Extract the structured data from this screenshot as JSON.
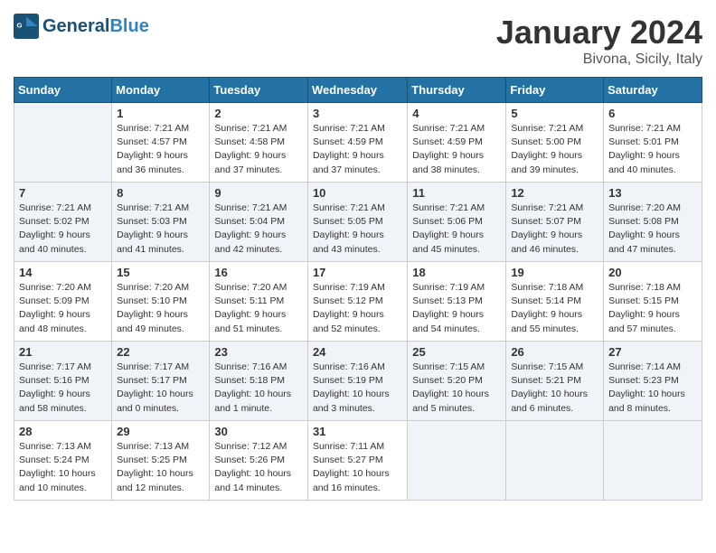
{
  "header": {
    "logo_line1": "General",
    "logo_line2": "Blue",
    "month_title": "January 2024",
    "subtitle": "Bivona, Sicily, Italy"
  },
  "weekdays": [
    "Sunday",
    "Monday",
    "Tuesday",
    "Wednesday",
    "Thursday",
    "Friday",
    "Saturday"
  ],
  "weeks": [
    [
      {
        "day": "",
        "info": ""
      },
      {
        "day": "1",
        "info": "Sunrise: 7:21 AM\nSunset: 4:57 PM\nDaylight: 9 hours\nand 36 minutes."
      },
      {
        "day": "2",
        "info": "Sunrise: 7:21 AM\nSunset: 4:58 PM\nDaylight: 9 hours\nand 37 minutes."
      },
      {
        "day": "3",
        "info": "Sunrise: 7:21 AM\nSunset: 4:59 PM\nDaylight: 9 hours\nand 37 minutes."
      },
      {
        "day": "4",
        "info": "Sunrise: 7:21 AM\nSunset: 4:59 PM\nDaylight: 9 hours\nand 38 minutes."
      },
      {
        "day": "5",
        "info": "Sunrise: 7:21 AM\nSunset: 5:00 PM\nDaylight: 9 hours\nand 39 minutes."
      },
      {
        "day": "6",
        "info": "Sunrise: 7:21 AM\nSunset: 5:01 PM\nDaylight: 9 hours\nand 40 minutes."
      }
    ],
    [
      {
        "day": "7",
        "info": "Sunrise: 7:21 AM\nSunset: 5:02 PM\nDaylight: 9 hours\nand 40 minutes."
      },
      {
        "day": "8",
        "info": "Sunrise: 7:21 AM\nSunset: 5:03 PM\nDaylight: 9 hours\nand 41 minutes."
      },
      {
        "day": "9",
        "info": "Sunrise: 7:21 AM\nSunset: 5:04 PM\nDaylight: 9 hours\nand 42 minutes."
      },
      {
        "day": "10",
        "info": "Sunrise: 7:21 AM\nSunset: 5:05 PM\nDaylight: 9 hours\nand 43 minutes."
      },
      {
        "day": "11",
        "info": "Sunrise: 7:21 AM\nSunset: 5:06 PM\nDaylight: 9 hours\nand 45 minutes."
      },
      {
        "day": "12",
        "info": "Sunrise: 7:21 AM\nSunset: 5:07 PM\nDaylight: 9 hours\nand 46 minutes."
      },
      {
        "day": "13",
        "info": "Sunrise: 7:20 AM\nSunset: 5:08 PM\nDaylight: 9 hours\nand 47 minutes."
      }
    ],
    [
      {
        "day": "14",
        "info": "Sunrise: 7:20 AM\nSunset: 5:09 PM\nDaylight: 9 hours\nand 48 minutes."
      },
      {
        "day": "15",
        "info": "Sunrise: 7:20 AM\nSunset: 5:10 PM\nDaylight: 9 hours\nand 49 minutes."
      },
      {
        "day": "16",
        "info": "Sunrise: 7:20 AM\nSunset: 5:11 PM\nDaylight: 9 hours\nand 51 minutes."
      },
      {
        "day": "17",
        "info": "Sunrise: 7:19 AM\nSunset: 5:12 PM\nDaylight: 9 hours\nand 52 minutes."
      },
      {
        "day": "18",
        "info": "Sunrise: 7:19 AM\nSunset: 5:13 PM\nDaylight: 9 hours\nand 54 minutes."
      },
      {
        "day": "19",
        "info": "Sunrise: 7:18 AM\nSunset: 5:14 PM\nDaylight: 9 hours\nand 55 minutes."
      },
      {
        "day": "20",
        "info": "Sunrise: 7:18 AM\nSunset: 5:15 PM\nDaylight: 9 hours\nand 57 minutes."
      }
    ],
    [
      {
        "day": "21",
        "info": "Sunrise: 7:17 AM\nSunset: 5:16 PM\nDaylight: 9 hours\nand 58 minutes."
      },
      {
        "day": "22",
        "info": "Sunrise: 7:17 AM\nSunset: 5:17 PM\nDaylight: 10 hours\nand 0 minutes."
      },
      {
        "day": "23",
        "info": "Sunrise: 7:16 AM\nSunset: 5:18 PM\nDaylight: 10 hours\nand 1 minute."
      },
      {
        "day": "24",
        "info": "Sunrise: 7:16 AM\nSunset: 5:19 PM\nDaylight: 10 hours\nand 3 minutes."
      },
      {
        "day": "25",
        "info": "Sunrise: 7:15 AM\nSunset: 5:20 PM\nDaylight: 10 hours\nand 5 minutes."
      },
      {
        "day": "26",
        "info": "Sunrise: 7:15 AM\nSunset: 5:21 PM\nDaylight: 10 hours\nand 6 minutes."
      },
      {
        "day": "27",
        "info": "Sunrise: 7:14 AM\nSunset: 5:23 PM\nDaylight: 10 hours\nand 8 minutes."
      }
    ],
    [
      {
        "day": "28",
        "info": "Sunrise: 7:13 AM\nSunset: 5:24 PM\nDaylight: 10 hours\nand 10 minutes."
      },
      {
        "day": "29",
        "info": "Sunrise: 7:13 AM\nSunset: 5:25 PM\nDaylight: 10 hours\nand 12 minutes."
      },
      {
        "day": "30",
        "info": "Sunrise: 7:12 AM\nSunset: 5:26 PM\nDaylight: 10 hours\nand 14 minutes."
      },
      {
        "day": "31",
        "info": "Sunrise: 7:11 AM\nSunset: 5:27 PM\nDaylight: 10 hours\nand 16 minutes."
      },
      {
        "day": "",
        "info": ""
      },
      {
        "day": "",
        "info": ""
      },
      {
        "day": "",
        "info": ""
      }
    ]
  ]
}
